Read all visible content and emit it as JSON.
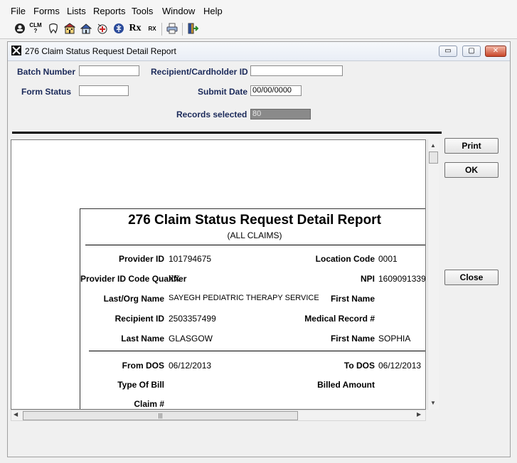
{
  "menu": [
    "File",
    "Forms",
    "Lists",
    "Reports",
    "Tools",
    "Window",
    "Help"
  ],
  "toolbar": {
    "icons": [
      "person-icon",
      "claim-icon",
      "tooth-icon",
      "hospital-icon",
      "house-icon",
      "medical-icon",
      "caduceus-icon",
      "rx-icon",
      "rx-small-icon",
      "printer-icon",
      "exit-icon"
    ],
    "clm_text": "CLM",
    "rx_text": "Rx",
    "rx_small_text": "RX"
  },
  "window": {
    "title": "276 Claim Status Request  Detail Report",
    "min_label": "▭",
    "max_label": "▢",
    "close_label": "✕"
  },
  "form": {
    "batch_number_label": "Batch Number",
    "batch_number_value": "",
    "recipient_label": "Recipient/Cardholder ID",
    "recipient_value": "",
    "form_status_label": "Form Status",
    "form_status_value": "",
    "submit_date_label": "Submit Date",
    "submit_date_value": "00/00/0000",
    "records_selected_label": "Records selected",
    "records_selected_value": "80"
  },
  "report": {
    "title": "276 Claim Status Request Detail Report",
    "subtitle": "(ALL CLAIMS)",
    "provider_id_label": "Provider ID",
    "provider_id_value": "101794675",
    "location_code_label": "Location Code",
    "location_code_value": "0001",
    "qualifier_label": "Provider ID Code Qualifier",
    "qualifier_value": "XX",
    "npi_label": "NPI",
    "npi_value": "1609091339",
    "org_name_label": "Last/Org Name",
    "org_name_value": "SAYEGH PEDIATRIC THERAPY SERVICE",
    "first_name_label": "First Name",
    "first_name_value": "",
    "recipient_id_label": "Recipient ID",
    "recipient_id_value": "2503357499",
    "medical_record_label": "Medical Record #",
    "medical_record_value": "",
    "last_name_label": "Last Name",
    "last_name_value": "GLASGOW",
    "first_name2_label": "First Name",
    "first_name2_value": "SOPHIA",
    "from_dos_label": "From DOS",
    "from_dos_value": "06/12/2013",
    "to_dos_label": "To DOS",
    "to_dos_value": "06/12/2013",
    "type_of_bill_label": "Type Of Bill",
    "billed_amount_label": "Billed Amount",
    "claim_label": "Claim #"
  },
  "buttons": {
    "print": "Print",
    "ok": "OK",
    "close": "Close"
  }
}
